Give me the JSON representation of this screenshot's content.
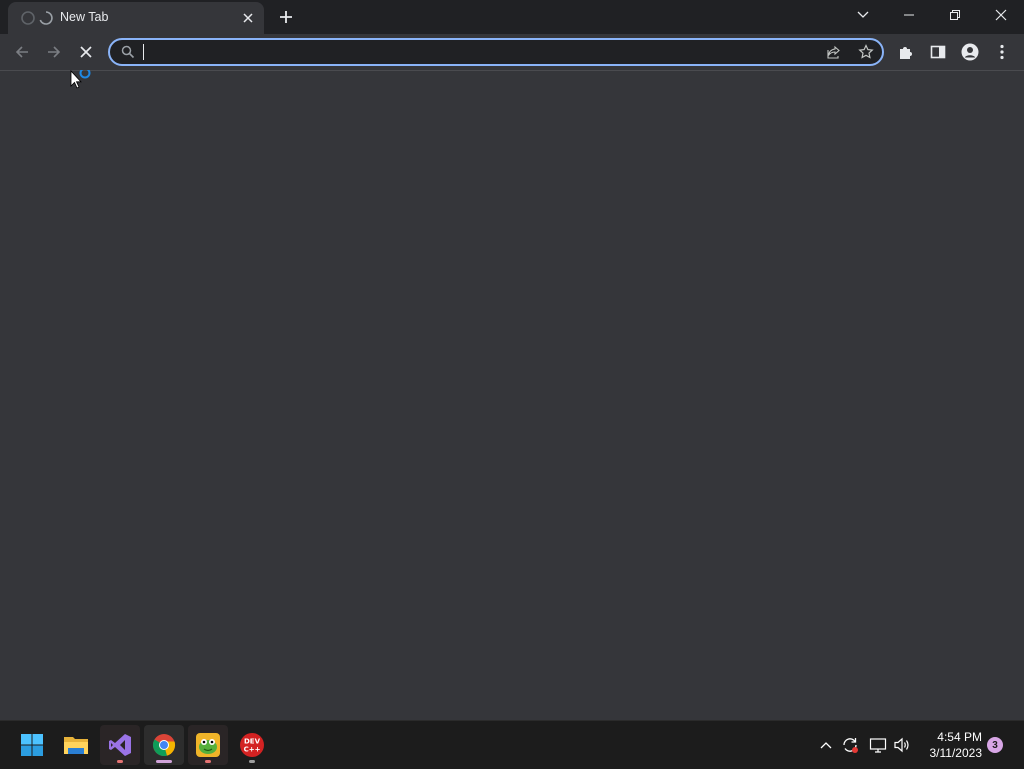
{
  "browser": {
    "tab": {
      "title": "New Tab",
      "loading": true
    },
    "omnibox": {
      "value": "",
      "placeholder": ""
    },
    "colors": {
      "frame": "#202124",
      "toolbar": "#35363a",
      "page": "#35363a",
      "focus_ring": "#8ab4f8"
    }
  },
  "taskbar": {
    "apps": [
      {
        "name": "Start",
        "icon": "windows-logo-icon"
      },
      {
        "name": "File Explorer",
        "icon": "folder-icon"
      },
      {
        "name": "Visual Studio",
        "icon": "visual-studio-icon"
      },
      {
        "name": "Google Chrome",
        "icon": "chrome-icon"
      },
      {
        "name": "Game",
        "icon": "frog-game-icon"
      },
      {
        "name": "Dev-C++",
        "icon": "devcpp-icon",
        "label": "DEV C++"
      }
    ],
    "clock": {
      "time": "4:54 PM",
      "date": "3/11/2023"
    },
    "notifications": {
      "count": "3"
    }
  }
}
